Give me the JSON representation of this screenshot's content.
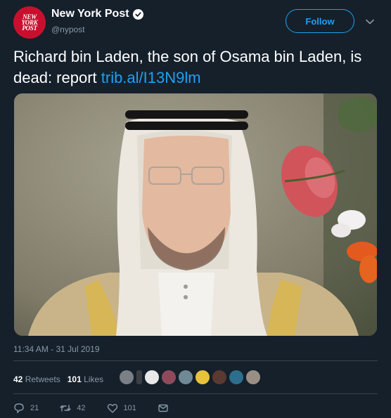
{
  "account": {
    "avatar_lines": [
      "NEW",
      "YORK",
      "POST"
    ],
    "name": "New York Post",
    "handle": "@nypost",
    "follow_label": "Follow"
  },
  "tweet": {
    "text": "Richard bin Laden, the son of Osama bin Laden, is dead: report ",
    "link": "trib.al/I13N9lm",
    "timestamp": "11:34 AM - 31 Jul 2019"
  },
  "stats": {
    "retweets_count": "42",
    "retweets_label": "Retweets",
    "likes_count": "101",
    "likes_label": "Likes"
  },
  "actions": {
    "reply_count": "21",
    "retweet_count": "42",
    "like_count": "101"
  },
  "colors": {
    "background": "#15202b",
    "accent": "#1da1f2",
    "muted": "#8899a6",
    "brand": "#c8102e"
  }
}
